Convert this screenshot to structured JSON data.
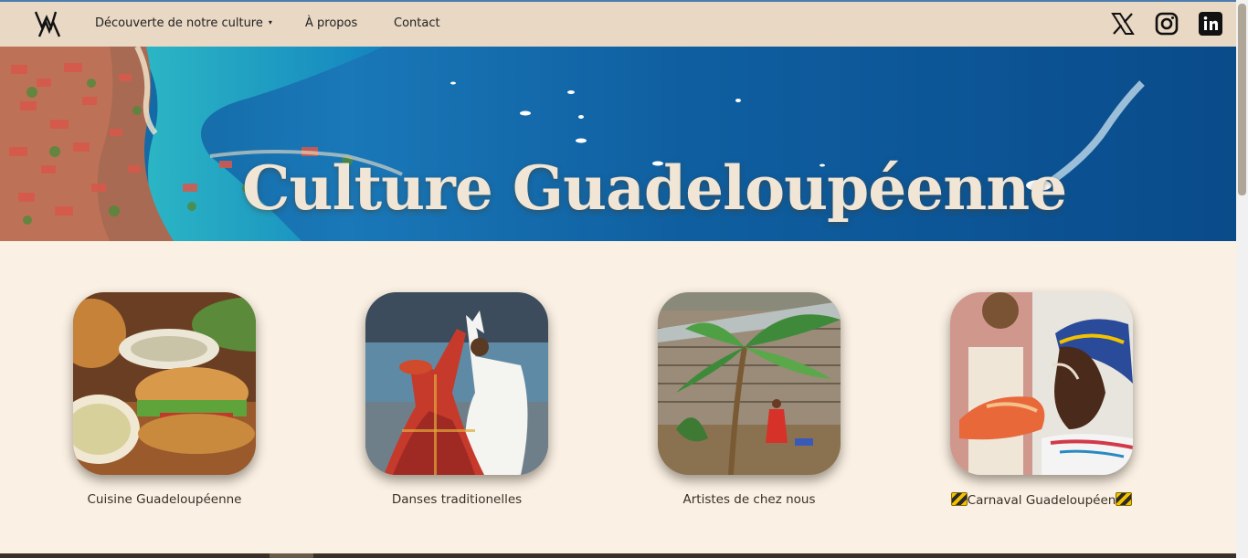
{
  "nav": {
    "logo_alt": "logo",
    "links": {
      "culture": "Découverte de notre culture",
      "apropos": "À propos",
      "contact": "Contact"
    },
    "caret": "▾",
    "social": [
      "x-icon",
      "instagram-icon",
      "linkedin-icon"
    ]
  },
  "hero": {
    "title": "Culture Guadeloupéenne"
  },
  "cards": [
    {
      "label": "Cuisine Guadeloupéenne",
      "image": "food-photo"
    },
    {
      "label": "Danses traditionelles",
      "image": "dance-photo"
    },
    {
      "label": "Artistes de chez nous",
      "image": "painting-photo"
    },
    {
      "label": "Carnaval Guadeloupéen",
      "image": "carnival-photo"
    }
  ],
  "colors": {
    "navbar_bg": "#e8d8c4",
    "page_bg": "#faf0e4",
    "hero_sea": "#1a78b8"
  }
}
